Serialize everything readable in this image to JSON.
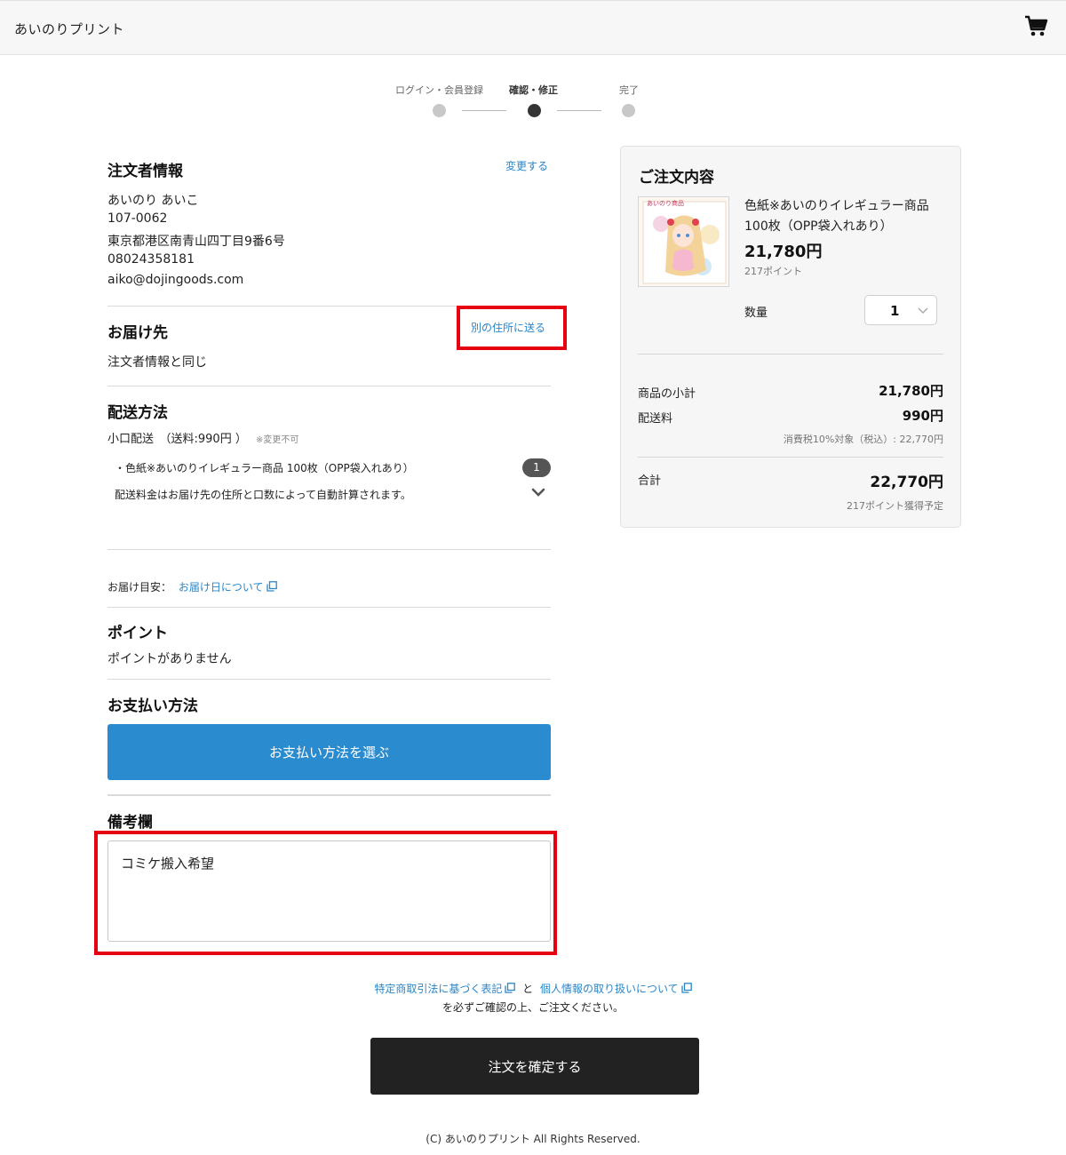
{
  "header": {
    "brand": "あいのりプリント",
    "cart_icon": "shopping-cart-icon"
  },
  "steps": [
    {
      "label": "ログイン・会員登録",
      "active": false
    },
    {
      "label": "確認・修正",
      "active": true
    },
    {
      "label": "完了",
      "active": false
    }
  ],
  "orderer": {
    "title": "注文者情報",
    "change_link": "変更する",
    "lines": [
      "あいのり あいこ",
      "107-0062",
      "東京都港区南青山四丁目9番6号",
      "08024358181",
      "aiko@dojingoods.com"
    ]
  },
  "delivery": {
    "title": "お届け先",
    "other_address_link": "別の住所に送る",
    "value": "注文者情報と同じ"
  },
  "shipping": {
    "title": "配送方法",
    "method": "小口配送　（送料:990円 ）",
    "note": "※変更不可",
    "item": "・色紙※あいのりイレギュラー商品 100枚（OPP袋入れあり）",
    "item_count": "1",
    "calc_note": "配送料金はお届け先の住所と口数によって自動計算されます。",
    "eta_label": "お届け目安：",
    "eta_link": "お届け日について"
  },
  "points": {
    "title": "ポイント",
    "value": "ポイントがありません"
  },
  "payment": {
    "title": "お支払い方法",
    "button": "お支払い方法を選ぶ"
  },
  "memo": {
    "title": "備考欄",
    "value": "コミケ搬入希望"
  },
  "summary": {
    "title": "ご注文内容",
    "product": {
      "name": "色紙※あいのりイレギュラー商品 100枚（OPP袋入れあり）",
      "price": "21,780円",
      "points": "217ポイント",
      "thumb_label": "あいのり商品"
    },
    "qty_label": "数量",
    "qty_value": "1",
    "subtotal_label": "商品の小計",
    "subtotal": "21,780円",
    "shipping_label": "配送料",
    "shipping": "990円",
    "tax_note": "消費税10%対象（税込）: 22,770円",
    "total_label": "合計",
    "total": "22,770円",
    "earn_points": "217ポイント獲得予定"
  },
  "legal": {
    "link1": "特定商取引法に基づく表記",
    "and": "と",
    "link2": "個人情報の取り扱いについて",
    "note": "を必ずご確認の上、ご注文ください。"
  },
  "confirm_button": "注文を確定する",
  "footer": "(C) あいのりプリント All Rights Reserved."
}
